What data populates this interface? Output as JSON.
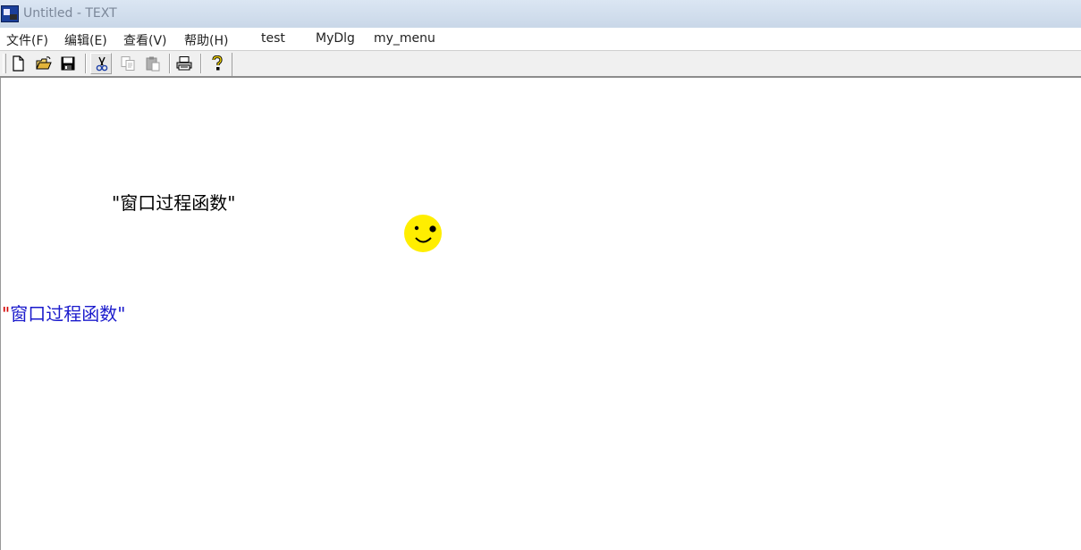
{
  "window": {
    "title": "Untitled - TEXT"
  },
  "menu": {
    "items": [
      {
        "label": "文件(F)"
      },
      {
        "label": "编辑(E)"
      },
      {
        "label": "查看(V)"
      },
      {
        "label": "帮助(H)"
      },
      {
        "label": "test"
      },
      {
        "label": "MyDlg"
      },
      {
        "label": "my_menu"
      }
    ]
  },
  "toolbar": {
    "buttons": [
      {
        "icon": "new-document-icon"
      },
      {
        "icon": "open-folder-icon"
      },
      {
        "icon": "save-disk-icon"
      },
      {
        "icon": "cut-scissors-icon"
      },
      {
        "icon": "copy-icon"
      },
      {
        "icon": "paste-icon"
      },
      {
        "icon": "print-icon"
      },
      {
        "icon": "help-icon"
      }
    ]
  },
  "client": {
    "text_black": "\"窗口过程函数\"",
    "text_blue_quote_open": "\"",
    "text_blue_body": "窗口过程函数\"",
    "smiley_color": "#ffee00",
    "blue_text_color": "#1a1acc",
    "red_quote_color": "#d40000"
  }
}
